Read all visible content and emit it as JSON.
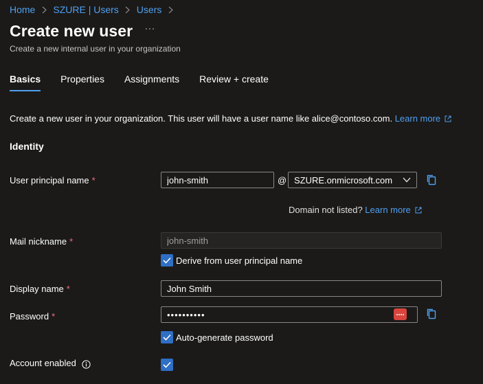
{
  "breadcrumb": [
    "Home",
    "SZURE | Users",
    "Users"
  ],
  "page": {
    "title": "Create new user",
    "subtitle": "Create a new internal user in your organization"
  },
  "tabs": [
    "Basics",
    "Properties",
    "Assignments",
    "Review + create"
  ],
  "intro": {
    "text": "Create a new user in your organization. This user will have a user name like alice@contoso.com.",
    "link": "Learn more"
  },
  "section": {
    "identity": "Identity"
  },
  "fields": {
    "upn": {
      "label": "User principal name",
      "value": "john-smith",
      "at": "@",
      "domain": "SZURE.onmicrosoft.com"
    },
    "domain_note": {
      "text": "Domain not listed?",
      "link": "Learn more"
    },
    "mail_nickname": {
      "label": "Mail nickname",
      "value": "john-smith",
      "derive_label": "Derive from user principal name",
      "derive_checked": true
    },
    "display_name": {
      "label": "Display name",
      "value": "John Smith"
    },
    "password": {
      "label": "Password",
      "value": "••••••••••",
      "autogen_label": "Auto-generate password",
      "autogen_checked": true
    },
    "account_enabled": {
      "label": "Account enabled",
      "checked": true
    }
  },
  "colors": {
    "accent": "#4fa0f0",
    "required": "#f1707b",
    "checkbox": "#2f6fc4",
    "reveal": "#d9453d"
  }
}
